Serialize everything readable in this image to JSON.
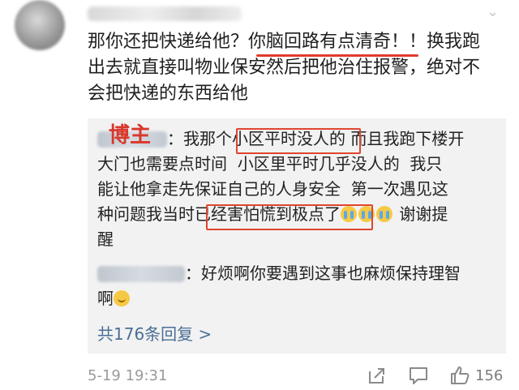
{
  "comment": {
    "text": "那你还把快递给他？你脑回路有点清奇！！换我跑\n出去就直接叫物业保安然后把他治住报警，绝对不\n会把快递的东西给他"
  },
  "replies": {
    "blogger_tag": "博主",
    "items": [
      {
        "text": "：我那个小区平时没人的 而且我跑下楼开\n大门也需要点时间  小区里平时几乎没人的  我只\n能让他拿走先保证自己的人身安全  第一次遇见这\n种问题我当时已经害怕慌到极点了",
        "tail": " 谢谢提\n醒"
      },
      {
        "text": "：好烦啊你要遇到这事也麻烦保持理智\n啊"
      }
    ],
    "more_label": "共176条回复 >"
  },
  "footer": {
    "timestamp": "5-19 19:31",
    "like_count": "156"
  },
  "icons": {
    "share": "share-icon",
    "comment": "comment-icon",
    "like": "like-icon",
    "menu": "chevron-down-icon"
  },
  "colors": {
    "highlight_red": "#e0452f",
    "link_blue": "#4a6f96",
    "reply_bg": "#f2f2f2"
  }
}
